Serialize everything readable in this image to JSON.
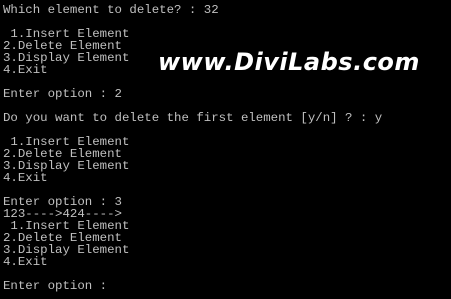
{
  "console": {
    "lines": [
      "Which element to delete? : 32",
      "",
      " 1.Insert Element",
      "2.Delete Element",
      "3.Display Element",
      "4.Exit",
      "",
      "Enter option : 2",
      "",
      "Do you want to delete the first element [y/n] ? : y",
      "",
      " 1.Insert Element",
      "2.Delete Element",
      "3.Display Element",
      "4.Exit",
      "",
      "Enter option : 3",
      "123---->424---->",
      " 1.Insert Element",
      "2.Delete Element",
      "3.Display Element",
      "4.Exit",
      "",
      "Enter option :"
    ]
  },
  "watermark": {
    "text": "www.DiviLabs.com"
  },
  "colors": {
    "background": "#000000",
    "text": "#c0c0c0",
    "watermark": "#ffffff"
  }
}
